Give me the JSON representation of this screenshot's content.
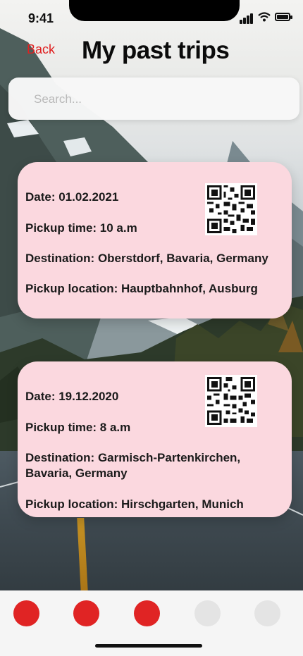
{
  "status_bar": {
    "time": "9:41"
  },
  "header": {
    "back_label": "Back",
    "title": "My past trips"
  },
  "search": {
    "placeholder": "Search..."
  },
  "trips": [
    {
      "date": "Date: 01.02.2021",
      "pickup_time": "Pickup time: 10 a.m",
      "destination": "Destination: Oberstdorf, Bavaria, Germany",
      "pickup_location": "Pickup location: Hauptbahnhof, Ausburg"
    },
    {
      "date": "Date: 19.12.2020",
      "pickup_time": "Pickup time: 8 a.m",
      "destination_line1": "Destination: Garmisch-Partenkirchen,",
      "destination_line2": "Bavaria, Germany",
      "pickup_location": "Pickup location: Hirschgarten, Munich"
    }
  ],
  "tab_bar": {
    "items": [
      {
        "state": "active",
        "color": "#e02424"
      },
      {
        "state": "active",
        "color": "#e02424"
      },
      {
        "state": "active",
        "color": "#e02424"
      },
      {
        "state": "inactive",
        "color": "#e4e4e4"
      },
      {
        "state": "inactive",
        "color": "#e4e4e4"
      }
    ]
  },
  "colors": {
    "accent": "#e02020",
    "card": "#fbd8df",
    "title": "#0b0b0b"
  }
}
